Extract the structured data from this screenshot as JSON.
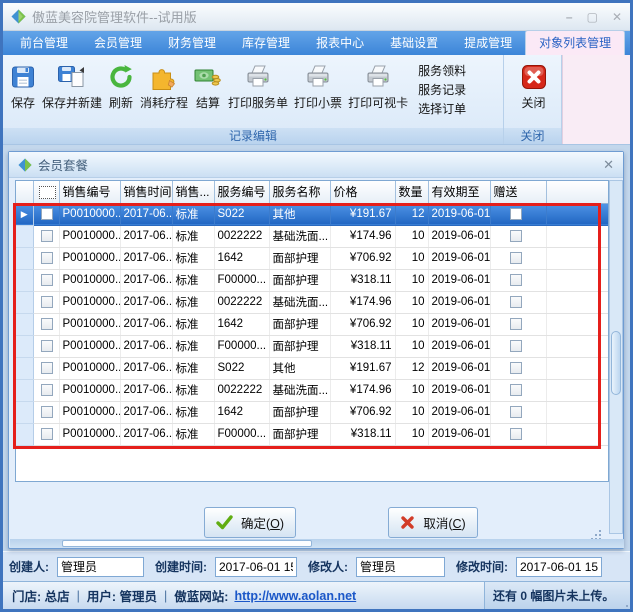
{
  "window": {
    "title": "傲蓝美容院管理软件--试用版"
  },
  "menu_tabs": [
    {
      "label": "前台管理",
      "active": false
    },
    {
      "label": "会员管理",
      "active": false
    },
    {
      "label": "财务管理",
      "active": false
    },
    {
      "label": "库存管理",
      "active": false
    },
    {
      "label": "报表中心",
      "active": false
    },
    {
      "label": "基础设置",
      "active": false
    },
    {
      "label": "提成管理",
      "active": false
    },
    {
      "label": "对象列表管理",
      "active": true
    }
  ],
  "ribbon": {
    "big_buttons": [
      {
        "label": "保存",
        "icon": "save-icon"
      },
      {
        "label": "保存并新建",
        "icon": "save-new-icon"
      },
      {
        "label": "刷新",
        "icon": "refresh-icon"
      },
      {
        "label": "消耗疗程",
        "icon": "consume-treatment-icon"
      },
      {
        "label": "结算",
        "icon": "settle-money-icon"
      },
      {
        "label": "打印服务单",
        "icon": "printer-icon"
      },
      {
        "label": "打印小票",
        "icon": "printer-icon"
      },
      {
        "label": "打印可视卡",
        "icon": "printer-icon"
      }
    ],
    "small_buttons": [
      {
        "label": "服务领料"
      },
      {
        "label": "服务记录"
      },
      {
        "label": "选择订单"
      }
    ],
    "group1_label": "记录编辑",
    "close_button_label": "关闭",
    "group2_label": "关闭"
  },
  "dialog": {
    "title": "会员套餐",
    "table": {
      "columns": [
        "销售编号",
        "销售时间",
        "销售...",
        "服务编号",
        "服务名称",
        "价格",
        "数量",
        "有效期至",
        "赠送"
      ],
      "rows": [
        {
          "sale_no": "P0010000...",
          "sale_time": "2017-06...",
          "sale_type": "标准",
          "service_no": "S022",
          "service_name": "其他",
          "price": "¥191.67",
          "qty": "12",
          "valid_until": "2019-06-01",
          "selected": true
        },
        {
          "sale_no": "P0010000...",
          "sale_time": "2017-06...",
          "sale_type": "标准",
          "service_no": "0022222",
          "service_name": "基础洗面...",
          "price": "¥174.96",
          "qty": "10",
          "valid_until": "2019-06-01",
          "selected": false
        },
        {
          "sale_no": "P0010000...",
          "sale_time": "2017-06...",
          "sale_type": "标准",
          "service_no": "1642",
          "service_name": "面部护理",
          "price": "¥706.92",
          "qty": "10",
          "valid_until": "2019-06-01",
          "selected": false
        },
        {
          "sale_no": "P0010000...",
          "sale_time": "2017-06...",
          "sale_type": "标准",
          "service_no": "F00000...",
          "service_name": "面部护理",
          "price": "¥318.11",
          "qty": "10",
          "valid_until": "2019-06-01",
          "selected": false
        },
        {
          "sale_no": "P0010000...",
          "sale_time": "2017-06...",
          "sale_type": "标准",
          "service_no": "0022222",
          "service_name": "基础洗面...",
          "price": "¥174.96",
          "qty": "10",
          "valid_until": "2019-06-01",
          "selected": false
        },
        {
          "sale_no": "P0010000...",
          "sale_time": "2017-06...",
          "sale_type": "标准",
          "service_no": "1642",
          "service_name": "面部护理",
          "price": "¥706.92",
          "qty": "10",
          "valid_until": "2019-06-01",
          "selected": false
        },
        {
          "sale_no": "P0010000...",
          "sale_time": "2017-06...",
          "sale_type": "标准",
          "service_no": "F00000...",
          "service_name": "面部护理",
          "price": "¥318.11",
          "qty": "10",
          "valid_until": "2019-06-01",
          "selected": false
        },
        {
          "sale_no": "P0010000...",
          "sale_time": "2017-06...",
          "sale_type": "标准",
          "service_no": "S022",
          "service_name": "其他",
          "price": "¥191.67",
          "qty": "12",
          "valid_until": "2019-06-01",
          "selected": false
        },
        {
          "sale_no": "P0010000...",
          "sale_time": "2017-06...",
          "sale_type": "标准",
          "service_no": "0022222",
          "service_name": "基础洗面...",
          "price": "¥174.96",
          "qty": "10",
          "valid_until": "2019-06-01",
          "selected": false
        },
        {
          "sale_no": "P0010000...",
          "sale_time": "2017-06...",
          "sale_type": "标准",
          "service_no": "1642",
          "service_name": "面部护理",
          "price": "¥706.92",
          "qty": "10",
          "valid_until": "2019-06-01",
          "selected": false
        },
        {
          "sale_no": "P0010000...",
          "sale_time": "2017-06...",
          "sale_type": "标准",
          "service_no": "F00000...",
          "service_name": "面部护理",
          "price": "¥318.11",
          "qty": "10",
          "valid_until": "2019-06-01",
          "selected": false
        }
      ]
    },
    "ok_button": {
      "pre": "确定(",
      "mnemonic": "O",
      "post": ")"
    },
    "cancel_button": {
      "pre": "取消(",
      "mnemonic": "C",
      "post": ")"
    }
  },
  "footer_fields": [
    {
      "label": "创建人:",
      "value": "管理员"
    },
    {
      "label": "创建时间:",
      "value": "2017-06-01 15"
    },
    {
      "label": "修改人:",
      "value": "管理员"
    },
    {
      "label": "修改时间:",
      "value": "2017-06-01 15"
    }
  ],
  "status_bar": {
    "store_label": "门店: 总店",
    "sep": "|",
    "user_label": "用户: 管理员",
    "website_label": "傲蓝网站:",
    "website_url": "http://www.aolan.net",
    "right_text": "还有 0 幅图片未上传。"
  },
  "colors": {
    "accent_blue": "#3c85d8",
    "selected_row_blue": "#2166c2",
    "active_tab_pink": "#fbe9f6",
    "annotation_red": "#e51f1b"
  }
}
